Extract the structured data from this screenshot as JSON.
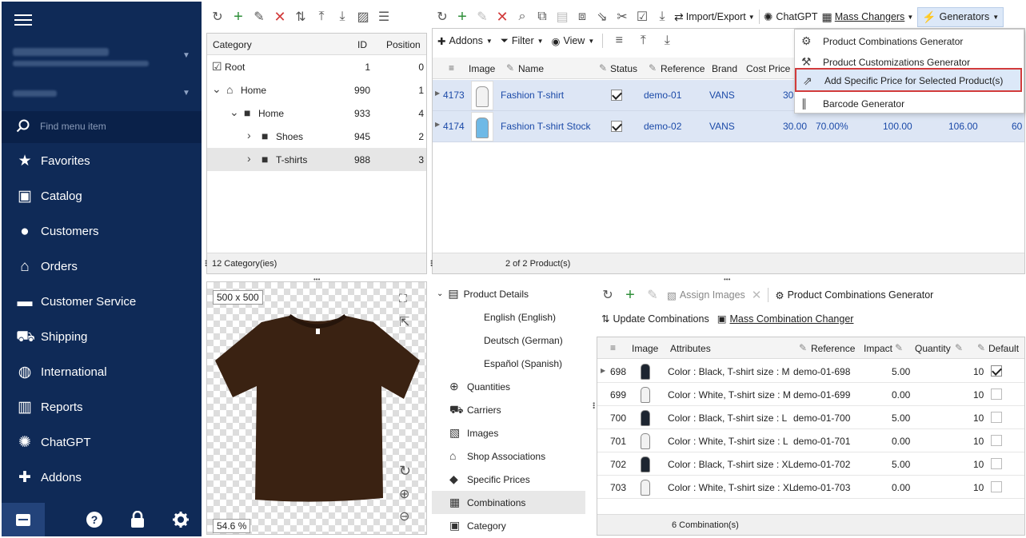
{
  "sidebar": {
    "search_placeholder": "Find menu item",
    "items": [
      {
        "label": "Favorites",
        "icon": "star-icon"
      },
      {
        "label": "Catalog",
        "icon": "catalog-icon"
      },
      {
        "label": "Customers",
        "icon": "user-icon"
      },
      {
        "label": "Orders",
        "icon": "orders-icon"
      },
      {
        "label": "Customer Service",
        "icon": "chat-icon"
      },
      {
        "label": "Shipping",
        "icon": "truck-icon"
      },
      {
        "label": "International",
        "icon": "globe-icon"
      },
      {
        "label": "Reports",
        "icon": "chart-icon"
      },
      {
        "label": "ChatGPT",
        "icon": "chatgpt-icon"
      },
      {
        "label": "Addons",
        "icon": "puzzle-icon"
      }
    ]
  },
  "category_panel": {
    "headers": {
      "category": "Category",
      "id": "ID",
      "position": "Position"
    },
    "rows": [
      {
        "name": "Root",
        "id": "1",
        "position": "0"
      },
      {
        "name": "Home",
        "id": "990",
        "position": "1"
      },
      {
        "name": "Home",
        "id": "933",
        "position": "4"
      },
      {
        "name": "Shoes",
        "id": "945",
        "position": "2"
      },
      {
        "name": "T-shirts",
        "id": "988",
        "position": "3"
      }
    ],
    "status": "12 Category(ies)"
  },
  "image_panel": {
    "size_tag": "500 x 500",
    "zoom_tag": "54.6 %"
  },
  "product_toolbar": {
    "import_export": "Import/Export",
    "chatgpt": "ChatGPT",
    "mass_changers": "Mass Changers",
    "generators": "Generators",
    "addons": "Addons",
    "filter": "Filter",
    "view": "View"
  },
  "product_grid": {
    "headers": {
      "image": "Image",
      "name": "Name",
      "status": "Status",
      "reference": "Reference",
      "brand": "Brand",
      "cost_price": "Cost Price"
    },
    "rows": [
      {
        "id": "4173",
        "name": "Fashion T-shirt",
        "reference": "demo-01",
        "brand": "VANS",
        "cost": "30.",
        "c2": "",
        "c3": "",
        "c4": "",
        "c5": ""
      },
      {
        "id": "4174",
        "name": "Fashion T-shirt Stock",
        "reference": "demo-02",
        "brand": "VANS",
        "cost": "30.00",
        "c2": "70.00%",
        "c3": "100.00",
        "c4": "106.00",
        "c5": "60"
      }
    ],
    "status": "2 of 2 Product(s)"
  },
  "generators_menu": {
    "items": [
      {
        "label": "Product Combinations Generator"
      },
      {
        "label": "Product Customizations Generator"
      },
      {
        "label": "Add Specific Price for Selected Product(s)"
      },
      {
        "label": "Barcode Generator"
      }
    ]
  },
  "detail_nav": {
    "product_details": "Product Details",
    "languages": [
      "English (English)",
      "Deutsch (German)",
      "Español (Spanish)"
    ],
    "items": [
      {
        "label": "Quantities",
        "icon": "quantities-icon"
      },
      {
        "label": "Carriers",
        "icon": "truck-icon"
      },
      {
        "label": "Images",
        "icon": "image-icon"
      },
      {
        "label": "Shop Associations",
        "icon": "shop-icon"
      },
      {
        "label": "Specific Prices",
        "icon": "tag-icon"
      },
      {
        "label": "Combinations",
        "icon": "grid-icon"
      },
      {
        "label": "Category",
        "icon": "folder-check-icon"
      }
    ]
  },
  "combinations": {
    "toolbar": {
      "assign_images": "Assign Images",
      "generator": "Product Combinations Generator",
      "update": "Update Combinations",
      "mass_changer": "Mass Combination Changer"
    },
    "headers": {
      "image": "Image",
      "attributes": "Attributes",
      "reference": "Reference",
      "impact": "Impact",
      "quantity": "Quantity",
      "default": "Default"
    },
    "rows": [
      {
        "id": "698",
        "attr": "Color : Black, T-shirt size : M",
        "ref": "demo-01-698",
        "impact": "5.00",
        "qty": "10",
        "default": true,
        "shirt": "black"
      },
      {
        "id": "699",
        "attr": "Color : White, T-shirt size : M",
        "ref": "demo-01-699",
        "impact": "0.00",
        "qty": "10",
        "default": false,
        "shirt": "white"
      },
      {
        "id": "700",
        "attr": "Color : Black, T-shirt size : L",
        "ref": "demo-01-700",
        "impact": "5.00",
        "qty": "10",
        "default": false,
        "shirt": "black"
      },
      {
        "id": "701",
        "attr": "Color : White, T-shirt size : L",
        "ref": "demo-01-701",
        "impact": "0.00",
        "qty": "10",
        "default": false,
        "shirt": "white"
      },
      {
        "id": "702",
        "attr": "Color : Black, T-shirt size : XL",
        "ref": "demo-01-702",
        "impact": "5.00",
        "qty": "10",
        "default": false,
        "shirt": "black"
      },
      {
        "id": "703",
        "attr": "Color : White, T-shirt size : XL",
        "ref": "demo-01-703",
        "impact": "0.00",
        "qty": "10",
        "default": false,
        "shirt": "white"
      }
    ],
    "status": "6 Combination(s)"
  },
  "colors": {
    "sidebar": "#0f2a57",
    "accent": "#2f8f3a",
    "highlight": "#d23b3b",
    "link": "#1b4aa8"
  }
}
